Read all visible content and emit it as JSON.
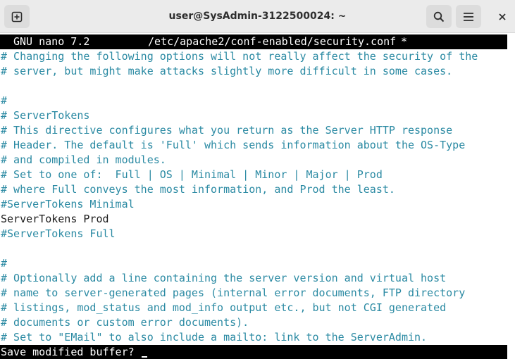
{
  "window": {
    "title": "user@SysAdmin-3122500024: ~",
    "new_tab_icon": "plus-square-icon",
    "search_icon": "search-icon",
    "menu_icon": "hamburger-menu-icon",
    "close_icon": "close-icon"
  },
  "nano": {
    "version": "GNU nano 7.2",
    "filename": "/etc/apache2/conf-enabled/security.conf",
    "modified_marker": "*"
  },
  "colors": {
    "comment": "#2b8aa3",
    "text": "#1a1a1a",
    "bar_bg": "#000000",
    "bar_fg": "#ffffff"
  },
  "lines": [
    {
      "text": "# Changing the following options will not really affect the security of the",
      "kind": "comment"
    },
    {
      "text": "# server, but might make attacks slightly more difficult in some cases.",
      "kind": "comment"
    },
    {
      "text": "",
      "kind": "blank"
    },
    {
      "text": "#",
      "kind": "comment"
    },
    {
      "text": "# ServerTokens",
      "kind": "comment"
    },
    {
      "text": "# This directive configures what you return as the Server HTTP response",
      "kind": "comment"
    },
    {
      "text": "# Header. The default is 'Full' which sends information about the OS-Type",
      "kind": "comment"
    },
    {
      "text": "# and compiled in modules.",
      "kind": "comment"
    },
    {
      "text": "# Set to one of:  Full | OS | Minimal | Minor | Major | Prod",
      "kind": "comment"
    },
    {
      "text": "# where Full conveys the most information, and Prod the least.",
      "kind": "comment"
    },
    {
      "text": "#ServerTokens Minimal",
      "kind": "comment"
    },
    {
      "text": "ServerTokens Prod",
      "kind": "plain"
    },
    {
      "text": "#ServerTokens Full",
      "kind": "comment"
    },
    {
      "text": "",
      "kind": "blank"
    },
    {
      "text": "#",
      "kind": "comment"
    },
    {
      "text": "# Optionally add a line containing the server version and virtual host",
      "kind": "comment"
    },
    {
      "text": "# name to server-generated pages (internal error documents, FTP directory",
      "kind": "comment"
    },
    {
      "text": "# listings, mod_status and mod_info output etc., but not CGI generated",
      "kind": "comment"
    },
    {
      "text": "# documents or custom error documents).",
      "kind": "comment"
    },
    {
      "text": "# Set to \"EMail\" to also include a mailto: link to the ServerAdmin.",
      "kind": "comment"
    }
  ],
  "prompt": {
    "text": "Save modified buffer?"
  }
}
